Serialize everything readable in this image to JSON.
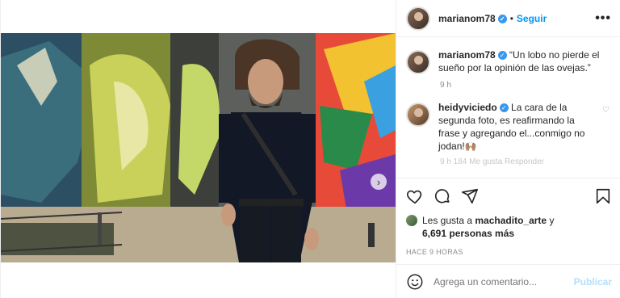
{
  "post": {
    "author": "marianom78",
    "follow_label": "Seguir",
    "separator": "•",
    "more_label": "•••"
  },
  "caption": {
    "author": "marianom78",
    "text_line1": "“Un lobo no pierde el",
    "text_line2": "sueño por la opinión de las ovejas.”",
    "time": "9 h"
  },
  "comment": {
    "author": "heidyviciedo",
    "line1": "La cara de la",
    "line2": "segunda foto, es reafirmando la",
    "line3": "frase y agregando el...conmigo no",
    "line4": "jodan!🙌🏽",
    "faded_meta": "9 h  184 Me gusta  Responder"
  },
  "likes": {
    "prefix": "Les gusta a",
    "user": "machadito_arte",
    "suffix": "y",
    "others": "6,691 personas más"
  },
  "timestamp": "HACE 9 HORAS",
  "add_comment": {
    "placeholder": "Agrega un comentario...",
    "publish_label": "Publicar"
  },
  "colors": {
    "accent": "#0095f6",
    "verified": "#3897f0",
    "publish_disabled": "#b2dffc"
  },
  "carousel": {
    "slides": 2,
    "current": 1
  }
}
